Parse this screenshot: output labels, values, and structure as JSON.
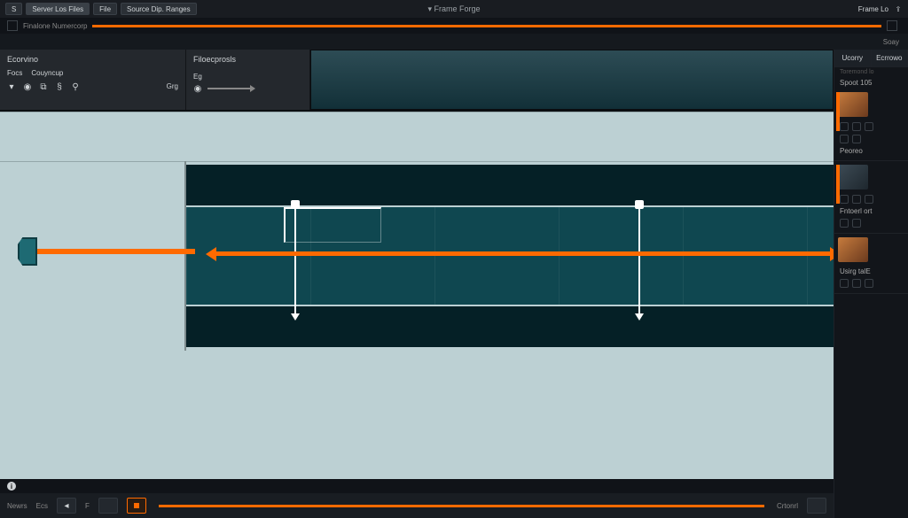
{
  "menubar": {
    "title_center": "▾ Frame Forge",
    "tabs": [
      "S",
      "Server Los Files",
      "File",
      "Source Dip. Ranges"
    ],
    "right": {
      "workspace_label": "Frame Lo",
      "share_icon": "share"
    }
  },
  "subbar": {
    "left_label": "Finalone Numercorp",
    "right_label": "Soay"
  },
  "tertbar": {
    "right_label": ""
  },
  "panel_a": {
    "header": "Ecorvino",
    "col1": "Focs",
    "col2": "Couyncup",
    "tool_icons": [
      "chevron-down",
      "target",
      "copy",
      "select",
      "anchor"
    ],
    "tool_right": "Grg"
  },
  "panel_b": {
    "header": "Filoecprosls",
    "sub": "Eg"
  },
  "right_panel": {
    "tabs": [
      "Ucorry",
      "Ecrrowo"
    ],
    "sub": "Toremond lo",
    "stat1": "Spoot  105",
    "section_labels": [
      "Peoreo",
      "Fntoerl ort",
      "Usirg talE"
    ]
  },
  "transport": {
    "left_labels": [
      "Newrs",
      "Ecs",
      "F"
    ],
    "right_labels": [
      "Crtonrl",
      ""
    ]
  },
  "status": {
    "info": "i"
  },
  "colors": {
    "accent": "#ff6a00",
    "teal": "#0f4750",
    "canvas": "#bcd0d3"
  }
}
